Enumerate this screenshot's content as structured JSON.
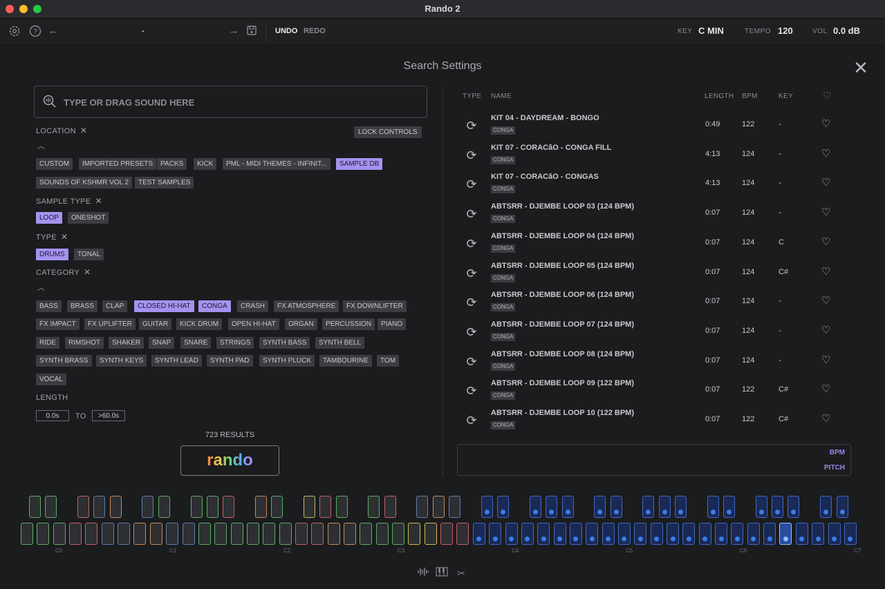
{
  "window": {
    "title": "Rando 2"
  },
  "toolbar": {
    "preset_name": "-",
    "undo": "UNDO",
    "redo": "REDO",
    "key_label": "KEY",
    "key_value": "C MIN",
    "tempo_label": "TEMPO",
    "tempo_value": "120",
    "vol_label": "VOL",
    "vol_value": "0.0 dB"
  },
  "panel": {
    "title": "Search Settings"
  },
  "search": {
    "placeholder": "TYPE OR DRAG SOUND HERE"
  },
  "filters": {
    "location_label": "LOCATION",
    "lock_controls": "LOCK CONTROLS",
    "location_tags": [
      {
        "label": "CUSTOM",
        "selected": false
      },
      {
        "label": "IMPORTED PRESETS",
        "selected": false
      },
      {
        "label": "PACKS",
        "selected": false
      },
      {
        "label": "KICK",
        "selected": false
      },
      {
        "label": "PML - MIDI THEMES - INFINIT...",
        "selected": false
      },
      {
        "label": "SAMPLE DB",
        "selected": true
      },
      {
        "label": "SOUNDS OF KSHMR VOL 2",
        "selected": false
      },
      {
        "label": "TEST SAMPLES",
        "selected": false
      }
    ],
    "sample_type_label": "SAMPLE TYPE",
    "sample_type_tags": [
      {
        "label": "LOOP",
        "selected": true
      },
      {
        "label": "ONESHOT",
        "selected": false
      }
    ],
    "type_label": "TYPE",
    "type_tags": [
      {
        "label": "DRUMS",
        "selected": true
      },
      {
        "label": "TONAL",
        "selected": false
      }
    ],
    "category_label": "CATEGORY",
    "category_tags": [
      {
        "label": "BASS",
        "selected": false
      },
      {
        "label": "BRASS",
        "selected": false
      },
      {
        "label": "CLAP",
        "selected": false
      },
      {
        "label": "CLOSED HI-HAT",
        "selected": true
      },
      {
        "label": "CONGA",
        "selected": true
      },
      {
        "label": "CRASH",
        "selected": false
      },
      {
        "label": "FX ATMOSPHERE",
        "selected": false
      },
      {
        "label": "FX DOWNLIFTER",
        "selected": false
      },
      {
        "label": "FX IMPACT",
        "selected": false
      },
      {
        "label": "FX UPLIFTER",
        "selected": false
      },
      {
        "label": "GUITAR",
        "selected": false
      },
      {
        "label": "KICK DRUM",
        "selected": false
      },
      {
        "label": "OPEN HI-HAT",
        "selected": false
      },
      {
        "label": "ORGAN",
        "selected": false
      },
      {
        "label": "PERCUSSION",
        "selected": false
      },
      {
        "label": "PIANO",
        "selected": false
      },
      {
        "label": "RIDE",
        "selected": false
      },
      {
        "label": "RIMSHOT",
        "selected": false
      },
      {
        "label": "SHAKER",
        "selected": false
      },
      {
        "label": "SNAP",
        "selected": false
      },
      {
        "label": "SNARE",
        "selected": false
      },
      {
        "label": "STRINGS",
        "selected": false
      },
      {
        "label": "SYNTH BASS",
        "selected": false
      },
      {
        "label": "SYNTH BELL",
        "selected": false
      },
      {
        "label": "SYNTH BRASS",
        "selected": false
      },
      {
        "label": "SYNTH KEYS",
        "selected": false
      },
      {
        "label": "SYNTH LEAD",
        "selected": false
      },
      {
        "label": "SYNTH PAD",
        "selected": false
      },
      {
        "label": "SYNTH PLUCK",
        "selected": false
      },
      {
        "label": "TAMBOURINE",
        "selected": false
      },
      {
        "label": "TOM",
        "selected": false
      },
      {
        "label": "VOCAL",
        "selected": false
      }
    ],
    "length_label": "LENGTH",
    "length_min": "0.0s",
    "length_to": "TO",
    "length_max": ">60.0s"
  },
  "results": {
    "count_text": "723 RESULTS",
    "button": "rando"
  },
  "table": {
    "headers": {
      "type": "TYPE",
      "name": "NAME",
      "length": "LENGTH",
      "bpm": "BPM",
      "key": "KEY"
    },
    "rows": [
      {
        "name": "KIT 04 - DAYDREAM - BONGO",
        "category": "CONGA",
        "length": "0:49",
        "bpm": "122",
        "key": "-"
      },
      {
        "name": "KIT 07 - CORACãO - CONGA FILL",
        "category": "CONGA",
        "length": "4:13",
        "bpm": "124",
        "key": "-"
      },
      {
        "name": "KIT 07 - CORACãO - CONGAS",
        "category": "CONGA",
        "length": "4:13",
        "bpm": "124",
        "key": "-"
      },
      {
        "name": "ABTSRR - DJEMBE LOOP 03 (124 BPM)",
        "category": "CONGA",
        "length": "0:07",
        "bpm": "124",
        "key": "-"
      },
      {
        "name": "ABTSRR - DJEMBE LOOP 04 (124 BPM)",
        "category": "CONGA",
        "length": "0:07",
        "bpm": "124",
        "key": "C"
      },
      {
        "name": "ABTSRR - DJEMBE LOOP 05 (124 BPM)",
        "category": "CONGA",
        "length": "0:07",
        "bpm": "124",
        "key": "C#"
      },
      {
        "name": "ABTSRR - DJEMBE LOOP 06 (124 BPM)",
        "category": "CONGA",
        "length": "0:07",
        "bpm": "124",
        "key": "-"
      },
      {
        "name": "ABTSRR - DJEMBE LOOP 07 (124 BPM)",
        "category": "CONGA",
        "length": "0:07",
        "bpm": "124",
        "key": "-"
      },
      {
        "name": "ABTSRR - DJEMBE LOOP 08 (124 BPM)",
        "category": "CONGA",
        "length": "0:07",
        "bpm": "124",
        "key": "-"
      },
      {
        "name": "ABTSRR - DJEMBE LOOP 09 (122 BPM)",
        "category": "CONGA",
        "length": "0:07",
        "bpm": "122",
        "key": "C#"
      },
      {
        "name": "ABTSRR - DJEMBE LOOP 10 (122 BPM)",
        "category": "CONGA",
        "length": "0:07",
        "bpm": "122",
        "key": "C#"
      }
    ]
  },
  "controls": {
    "bpm": "BPM",
    "pitch": "PITCH"
  },
  "keyboard": {
    "octave_labels": [
      "C0",
      "C1",
      "C2",
      "C3",
      "C4",
      "C5",
      "C6",
      "C7"
    ],
    "active_key": "C6 region, 5th white key"
  }
}
